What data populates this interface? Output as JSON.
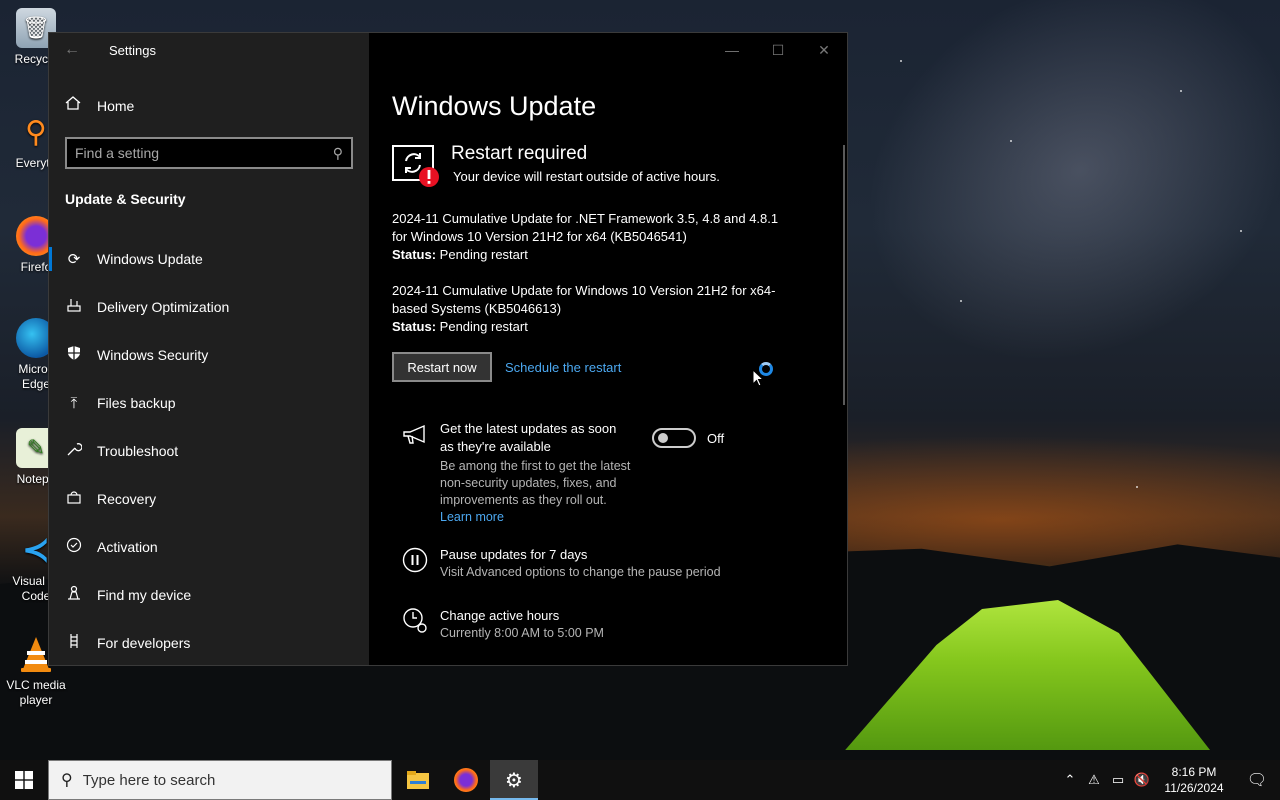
{
  "desktop": {
    "icons": [
      {
        "label": "Recycle",
        "icon": "recycle-bin-icon"
      },
      {
        "label": "Everyth",
        "icon": "everything-search-icon"
      },
      {
        "label": "Firefo",
        "icon": "firefox-icon"
      },
      {
        "label": "Micros\nEdge",
        "icon": "edge-icon"
      },
      {
        "label": "Notepa",
        "icon": "notepad-plus-icon"
      },
      {
        "label": "Visual St\nCode",
        "icon": "vscode-icon"
      },
      {
        "label": "VLC media\nplayer",
        "icon": "vlc-icon"
      }
    ]
  },
  "window": {
    "title": "Settings",
    "sidebar": {
      "home_label": "Home",
      "search_placeholder": "Find a setting",
      "section_title": "Update & Security",
      "items": [
        {
          "label": "Windows Update",
          "icon": "sync-icon"
        },
        {
          "label": "Delivery Optimization",
          "icon": "delivery-icon"
        },
        {
          "label": "Windows Security",
          "icon": "shield-icon"
        },
        {
          "label": "Files backup",
          "icon": "upload-icon"
        },
        {
          "label": "Troubleshoot",
          "icon": "wrench-icon"
        },
        {
          "label": "Recovery",
          "icon": "recovery-icon"
        },
        {
          "label": "Activation",
          "icon": "check-circle-icon"
        },
        {
          "label": "Find my device",
          "icon": "person-pin-icon"
        },
        {
          "label": "For developers",
          "icon": "developer-icon"
        }
      ]
    },
    "content": {
      "title": "Windows Update",
      "status_title": "Restart required",
      "status_subtitle": "Your device will restart outside of active hours.",
      "updates": [
        {
          "name_line1": "2024-11 Cumulative Update for .NET Framework 3.5, 4.8 and 4.8.1",
          "name_line2": "for Windows 10 Version 21H2 for x64 (KB5046541)",
          "status_label": "Status:",
          "status_value": " Pending restart"
        },
        {
          "name_line1": "2024-11 Cumulative Update for Windows 10 Version 21H2 for x64-",
          "name_line2": "based Systems (KB5046613)",
          "status_label": "Status:",
          "status_value": " Pending restart"
        }
      ],
      "restart_button": "Restart now",
      "schedule_link": "Schedule the restart",
      "latest_updates": {
        "head_line1": "Get the latest updates as soon",
        "head_line2": "as they're available",
        "desc": "Be among the first to get the latest non-security updates, fixes, and improvements as they roll out.",
        "link": "Learn more",
        "toggle_state": "Off"
      },
      "pause": {
        "head": "Pause updates for 7 days",
        "desc": "Visit Advanced options to change the pause period"
      },
      "active_hours": {
        "head": "Change active hours",
        "desc": "Currently 8:00 AM to 5:00 PM"
      }
    }
  },
  "taskbar": {
    "search_placeholder": "Type here to search",
    "apps": [
      "file-explorer-icon",
      "firefox-icon",
      "settings-gear-icon"
    ],
    "time": "8:16 PM",
    "date": "11/26/2024"
  }
}
